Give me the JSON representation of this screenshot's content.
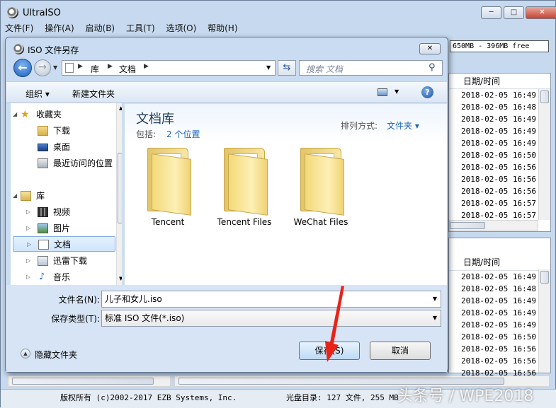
{
  "app": {
    "title": "UltraISO",
    "size_info": "650MB - 396MB free"
  },
  "menu": [
    "文件(F)",
    "操作(A)",
    "启动(B)",
    "工具(T)",
    "选项(O)",
    "帮助(H)"
  ],
  "window_controls": {
    "minimize": "─",
    "maximize": "□",
    "close": "✕"
  },
  "right_panel_top": {
    "header": "日期/时间",
    "rows": [
      "2018-02-05 16:49",
      "2018-02-05 16:48",
      "2018-02-05 16:49",
      "2018-02-05 16:49",
      "2018-02-05 16:49",
      "2018-02-05 16:50",
      "2018-02-05 16:56",
      "2018-02-05 16:56",
      "2018-02-05 16:56",
      "2018-02-05 16:57",
      "2018-02-05 16:57"
    ]
  },
  "right_panel_bottom": {
    "header": "日期/时间",
    "rows": [
      "2018-02-05 16:49",
      "2018-02-05 16:48",
      "2018-02-05 16:49",
      "2018-02-05 16:49",
      "2018-02-05 16:49",
      "2018-02-05 16:50",
      "2018-02-05 16:56",
      "2018-02-05 16:56",
      "2018-02-05 16:56"
    ]
  },
  "status": {
    "copyright": "版权所有 (c)2002-2017 EZB Systems, Inc.",
    "disc_info": "光盘目录: 127 文件, 255 MB",
    "watermark": "头条号 / WPE2018"
  },
  "dialog": {
    "title": "ISO 文件另存",
    "close": "✕",
    "breadcrumb": [
      "库",
      "文档"
    ],
    "search_placeholder": "搜索 文档",
    "organize": "组织 ▾",
    "new_folder": "新建文件夹",
    "help": "?",
    "nav": {
      "favorites": "收藏夹",
      "downloads": "下载",
      "desktop": "桌面",
      "recent": "最近访问的位置",
      "libraries": "库",
      "videos": "视频",
      "pictures": "图片",
      "documents": "文档",
      "thunder": "迅雷下载",
      "music": "音乐"
    },
    "library": {
      "title": "文档库",
      "includes_label": "包括:",
      "includes_link": "2 个位置",
      "arrange_label": "排列方式:",
      "arrange_value": "文件夹 ▾"
    },
    "folders": [
      "Tencent",
      "Tencent Files",
      "WeChat Files"
    ],
    "filename_label": "文件名(N):",
    "filename_value": "儿子和女儿.iso",
    "filetype_label": "保存类型(T):",
    "filetype_value": "标准 ISO 文件(*.iso)",
    "hide_folders": "隐藏文件夹",
    "save": "保存(S)",
    "cancel": "取消"
  }
}
